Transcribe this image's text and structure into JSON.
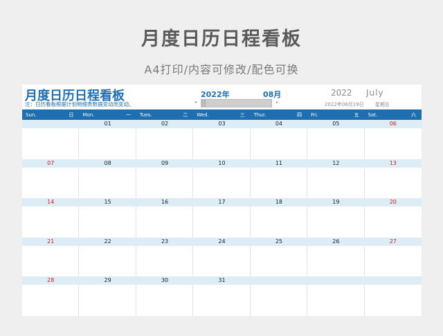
{
  "hero": {
    "title": "月度日历日程看板",
    "subtitle": "A4打印/内容可修改/配色可换"
  },
  "header": {
    "title": "月度日历日程看板",
    "note": "注：日历看板根据计划明细表数据变动而变动。",
    "year_cn": "2022年",
    "month_cn": "08月",
    "year_en": "2022",
    "month_en": "July",
    "today_date": "2022年08月19日",
    "today_weekday": "星期五"
  },
  "weekdays": [
    {
      "en": "Sun.",
      "cn": "日"
    },
    {
      "en": "Mon.",
      "cn": "一"
    },
    {
      "en": "Tues.",
      "cn": "二"
    },
    {
      "en": "Wed.",
      "cn": "三"
    },
    {
      "en": "Thur.",
      "cn": "四"
    },
    {
      "en": "Fri.",
      "cn": "五"
    },
    {
      "en": "Sat.",
      "cn": "六"
    }
  ],
  "weeks": [
    [
      "",
      "01",
      "02",
      "03",
      "04",
      "05",
      "06"
    ],
    [
      "07",
      "08",
      "09",
      "10",
      "11",
      "12",
      "13"
    ],
    [
      "14",
      "15",
      "16",
      "17",
      "18",
      "19",
      "20"
    ],
    [
      "21",
      "22",
      "23",
      "24",
      "25",
      "26",
      "27"
    ],
    [
      "28",
      "29",
      "30",
      "31",
      "",
      "",
      ""
    ]
  ],
  "colors": {
    "accent": "#1f6fb0",
    "date_band": "#dcedf8",
    "weekend": "#d21a1a"
  },
  "icons": {
    "scroll_left": "left-arrow-icon",
    "scroll_right": "right-arrow-icon"
  }
}
